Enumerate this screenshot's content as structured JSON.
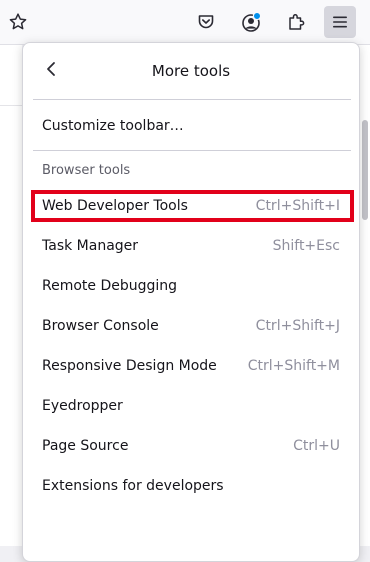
{
  "toolbar": {
    "icons": [
      "star-icon",
      "pocket-icon",
      "account-icon",
      "extensions-icon",
      "hamburger-menu-icon"
    ],
    "notification_color": "#0090ed"
  },
  "menu": {
    "title": "More tools",
    "customize_label": "Customize toolbar…",
    "section_label": "Browser tools",
    "items": [
      {
        "label": "Web Developer Tools",
        "shortcut": "Ctrl+Shift+I"
      },
      {
        "label": "Task Manager",
        "shortcut": "Shift+Esc"
      },
      {
        "label": "Remote Debugging",
        "shortcut": ""
      },
      {
        "label": "Browser Console",
        "shortcut": "Ctrl+Shift+J"
      },
      {
        "label": "Responsive Design Mode",
        "shortcut": "Ctrl+Shift+M"
      },
      {
        "label": "Eyedropper",
        "shortcut": ""
      },
      {
        "label": "Page Source",
        "shortcut": "Ctrl+U"
      },
      {
        "label": "Extensions for developers",
        "shortcut": ""
      }
    ]
  },
  "highlight_color": "#e2001a"
}
